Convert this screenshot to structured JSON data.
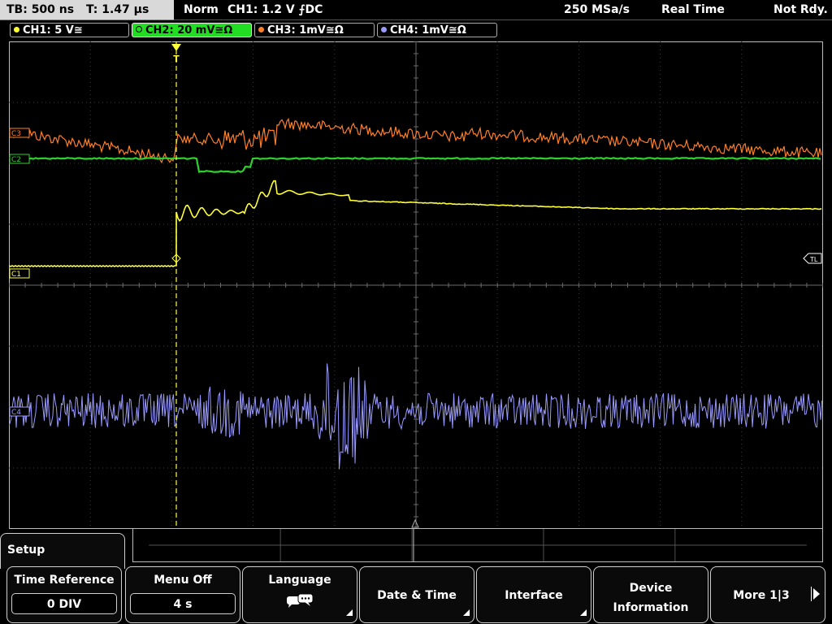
{
  "status": {
    "timebase": "TB: 500 ns",
    "trigger_time": "T: 1.47 µs",
    "mode": "Norm",
    "trigger_info": "CH1: 1.2 V ⨍DC",
    "sample_rate": "250 MSa/s",
    "acq_mode": "Real Time",
    "state": "Not Rdy."
  },
  "channels": [
    {
      "label": "CH1: 5 V≅",
      "color": "#ffff3a"
    },
    {
      "label": "CH2: 20 mV≅Ω",
      "color": "#2ed12e"
    },
    {
      "label": "CH3: 1mV≅Ω",
      "color": "#ff7f2a"
    },
    {
      "label": "CH4: 1mV≅Ω",
      "color": "#9a9aff"
    }
  ],
  "markers": {
    "ch1": "C1",
    "ch2": "C2",
    "ch3": "C3",
    "ch4": "C4",
    "trigger_level": "TL",
    "trigger_pos": "T"
  },
  "menu": {
    "title": "Setup",
    "time_reference": {
      "label": "Time Reference",
      "value": "0 DIV"
    },
    "menu_off": {
      "label": "Menu Off",
      "value": "4 s"
    },
    "language": {
      "label": "Language",
      "icon": "speech-bubbles-icon"
    },
    "date_time": {
      "label": "Date & Time"
    },
    "interface": {
      "label": "Interface"
    },
    "device_info": {
      "line1": "Device",
      "line2": "Information"
    },
    "more": {
      "label": "More 1|3"
    }
  }
}
